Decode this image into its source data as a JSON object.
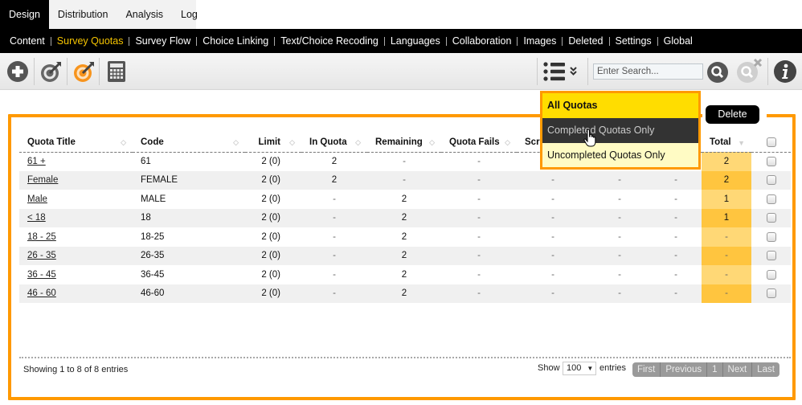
{
  "top_tabs": [
    {
      "label": "Design",
      "active": true
    },
    {
      "label": "Distribution",
      "active": false
    },
    {
      "label": "Analysis",
      "active": false
    },
    {
      "label": "Log",
      "active": false
    }
  ],
  "sub_nav": [
    {
      "label": "Content",
      "active": false
    },
    {
      "label": "Survey Quotas",
      "active": true
    },
    {
      "label": "Survey Flow",
      "active": false
    },
    {
      "label": "Choice Linking",
      "active": false
    },
    {
      "label": "Text/Choice Recoding",
      "active": false
    },
    {
      "label": "Languages",
      "active": false
    },
    {
      "label": "Collaboration",
      "active": false
    },
    {
      "label": "Images",
      "active": false
    },
    {
      "label": "Deleted",
      "active": false
    },
    {
      "label": "Settings",
      "active": false
    },
    {
      "label": "Global",
      "active": false
    }
  ],
  "toolbar": {
    "icons": [
      "add-icon",
      "target-icon",
      "target-active-icon",
      "calculator-icon",
      "list-icon",
      "double-chevron-down-icon",
      "search-icon",
      "clear-search-icon",
      "info-icon"
    ],
    "search_placeholder": "Enter Search...",
    "search_value": ""
  },
  "filter_dropdown": {
    "items": [
      {
        "label": "All Quotas",
        "state": "selected"
      },
      {
        "label": "Completed Quotas Only",
        "state": "hover"
      },
      {
        "label": "Uncompleted Quotas Only",
        "state": "normal"
      }
    ]
  },
  "delete_label": "Delete",
  "table": {
    "columns": [
      "Quota Title",
      "Code",
      "Limit",
      "In Quota",
      "Remaining",
      "Quota Fails",
      "Scre",
      "",
      "",
      "Total"
    ],
    "rows": [
      {
        "title": "61 +",
        "code": "61",
        "limit": "2 (0)",
        "in_quota": "2",
        "remaining": "-",
        "quota_fails": "-",
        "c7": "",
        "c8": "",
        "c9": "",
        "total": "2"
      },
      {
        "title": "Female",
        "code": "FEMALE",
        "limit": "2 (0)",
        "in_quota": "2",
        "remaining": "-",
        "quota_fails": "-",
        "c7": "-",
        "c8": "-",
        "c9": "-",
        "total": "2"
      },
      {
        "title": "Male",
        "code": "MALE",
        "limit": "2 (0)",
        "in_quota": "-",
        "remaining": "2",
        "quota_fails": "-",
        "c7": "-",
        "c8": "-",
        "c9": "-",
        "total": "1"
      },
      {
        "title": "< 18",
        "code": "18",
        "limit": "2 (0)",
        "in_quota": "-",
        "remaining": "2",
        "quota_fails": "-",
        "c7": "-",
        "c8": "-",
        "c9": "-",
        "total": "1"
      },
      {
        "title": "18 - 25",
        "code": "18-25",
        "limit": "2 (0)",
        "in_quota": "-",
        "remaining": "2",
        "quota_fails": "-",
        "c7": "-",
        "c8": "-",
        "c9": "-",
        "total": "-"
      },
      {
        "title": "26 - 35",
        "code": "26-35",
        "limit": "2 (0)",
        "in_quota": "-",
        "remaining": "2",
        "quota_fails": "-",
        "c7": "-",
        "c8": "-",
        "c9": "-",
        "total": "-"
      },
      {
        "title": "36 - 45",
        "code": "36-45",
        "limit": "2 (0)",
        "in_quota": "-",
        "remaining": "2",
        "quota_fails": "-",
        "c7": "-",
        "c8": "-",
        "c9": "-",
        "total": "-"
      },
      {
        "title": "46 - 60",
        "code": "46-60",
        "limit": "2 (0)",
        "in_quota": "-",
        "remaining": "2",
        "quota_fails": "-",
        "c7": "-",
        "c8": "-",
        "c9": "-",
        "total": "-"
      }
    ]
  },
  "footer": {
    "showing": "Showing 1 to 8 of 8 entries",
    "show_label": "Show",
    "page_length": "100",
    "entries_label": "entries",
    "pager": [
      "First",
      "Previous",
      "1",
      "Next",
      "Last"
    ]
  },
  "colors": {
    "accent_orange": "#ff9900",
    "active_nav": "#f5c400",
    "selected_yellow": "#ffdd00",
    "total_col_light": "#ffd876",
    "total_col_dark": "#ffc53f"
  }
}
